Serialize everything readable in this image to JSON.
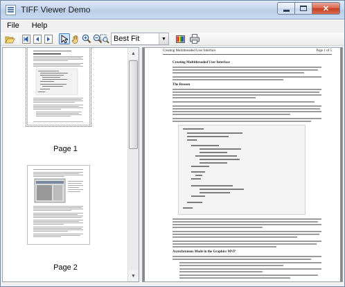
{
  "window": {
    "title": "TIFF Viewer Demo"
  },
  "menu": [
    {
      "label": "File"
    },
    {
      "label": "Help"
    }
  ],
  "toolbar": {
    "zoom_mode": "Best Fit",
    "icons": [
      "open-folder-icon",
      "first-page-icon",
      "previous-page-icon",
      "next-page-icon",
      "pointer-tool-icon",
      "pan-hand-icon",
      "zoom-in-icon",
      "zoom-out-icon",
      "zoom-fit-icon",
      "color-depth-icon",
      "print-icon"
    ]
  },
  "thumbnails": [
    {
      "label": "Page 1",
      "selected": true
    },
    {
      "label": "Page 2",
      "selected": false
    }
  ],
  "document": {
    "header_left": "Creating Multithreaded User Interface",
    "header_right": "Page 1 of 5",
    "heading": "Creating Multithreaded User Interface",
    "section1": "The Reason",
    "section2": "Asynchronous Mode in the Graphics MVP"
  }
}
